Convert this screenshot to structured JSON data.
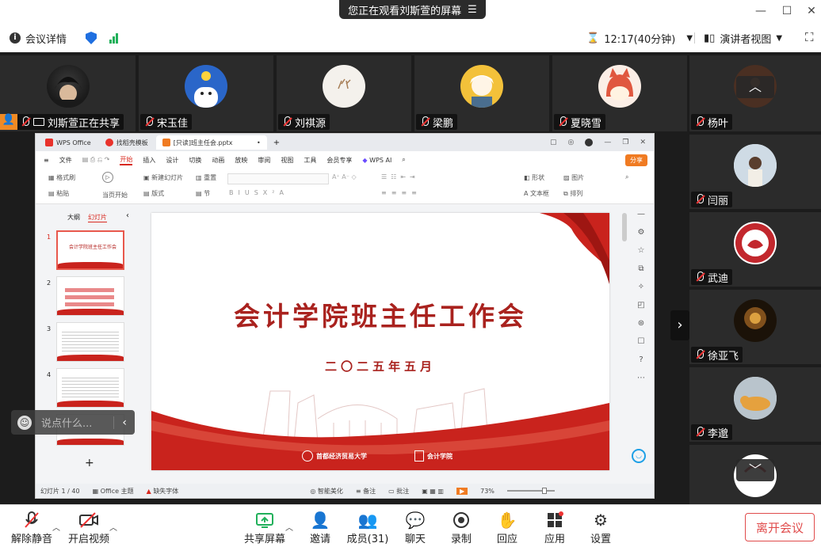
{
  "window": {
    "banner": "您正在观看刘斯萱的屏幕"
  },
  "meeting": {
    "details": "会议详情",
    "time": "12:17(40分钟)",
    "view": "演讲者视图"
  },
  "participants": {
    "top": [
      {
        "name": "刘斯萱正在共享"
      },
      {
        "name": "宋玉佳"
      },
      {
        "name": "刘祺源"
      },
      {
        "name": "梁鹏"
      },
      {
        "name": "夏晓雪"
      },
      {
        "name": "杨叶"
      }
    ],
    "right": [
      {
        "name": "闫丽"
      },
      {
        "name": "武迪"
      },
      {
        "name": "徐亚飞"
      },
      {
        "name": "李邈"
      }
    ]
  },
  "wps": {
    "tabs": [
      "WPS Office",
      "找稻壳模板",
      "[只读]班主任会.pptx"
    ],
    "menu": [
      "文件",
      "开始",
      "插入",
      "设计",
      "切换",
      "动画",
      "放映",
      "审阅",
      "视图",
      "工具",
      "会员专享",
      "WPS AI"
    ],
    "share": "分享",
    "ribbon": {
      "new_slide": "新建幻灯片",
      "layout": "版式",
      "section": "节",
      "reset": "重置",
      "play": "当页开始",
      "format_painter": "格式刷",
      "paste": "粘贴",
      "shape": "形状",
      "picture": "图片",
      "textbox": "文本框",
      "arrange": "排列"
    },
    "panel_tabs": [
      "大纲",
      "幻灯片"
    ],
    "slide": {
      "title": "会计学院班主任工作会",
      "date": "二〇二五年五月",
      "logo1": "首都经济贸易大学",
      "logo2": "会计学院"
    },
    "status": {
      "page": "幻灯片 1 / 40",
      "theme": "Office 主题",
      "font": "缺失字体",
      "beautify": "智能美化",
      "notes": "备注",
      "comment": "批注",
      "zoom": "73%"
    }
  },
  "chat": {
    "placeholder": "说点什么..."
  },
  "toolbar": {
    "mute": "解除静音",
    "video": "开启视频",
    "share": "共享屏幕",
    "invite": "邀请",
    "members": "成员(31)",
    "chat": "聊天",
    "record": "录制",
    "react": "回应",
    "apps": "应用",
    "settings": "设置",
    "leave": "离开会议"
  },
  "colors": {
    "accent": "#d8281e",
    "share_green": "#20b05a"
  }
}
